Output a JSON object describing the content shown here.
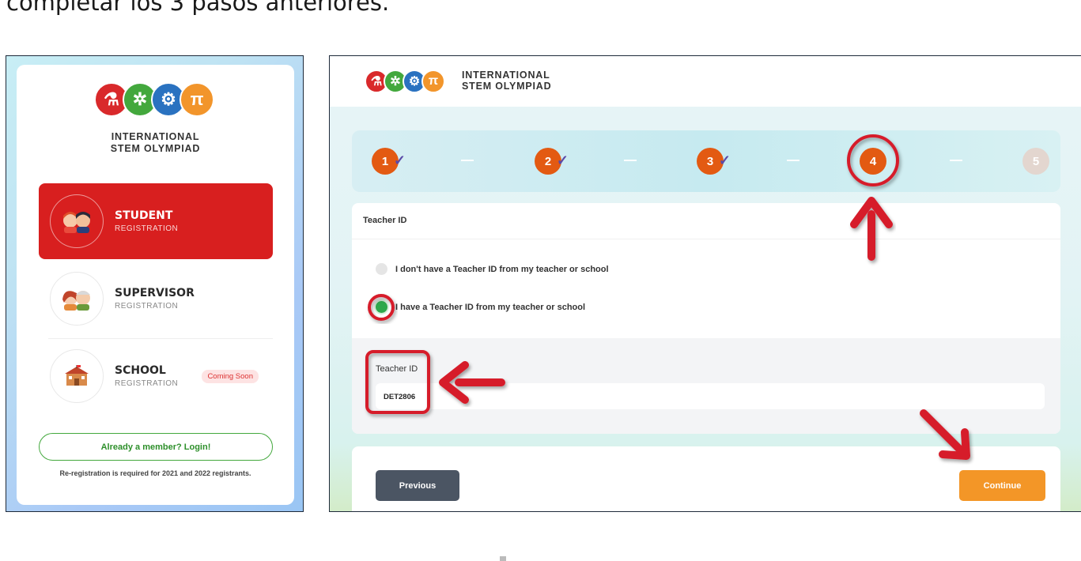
{
  "heading": "completar los 3 pasos anteriores.",
  "brand": {
    "line1": "INTERNATIONAL",
    "line2": "STEM OLYMPIAD",
    "logo_glyphs": [
      "⚗",
      "✲",
      "⚙",
      "π"
    ]
  },
  "registration": {
    "items": [
      {
        "title": "STUDENT",
        "subtitle": "REGISTRATION",
        "icon": "students-avatar-icon",
        "active": true
      },
      {
        "title": "SUPERVISOR",
        "subtitle": "REGISTRATION",
        "icon": "supervisors-avatar-icon",
        "active": false
      },
      {
        "title": "SCHOOL",
        "subtitle": "REGISTRATION",
        "icon": "school-building-icon",
        "active": false,
        "badge": "Coming Soon"
      }
    ],
    "login_label": "Already a member? Login!",
    "note": "Re-registration is required for 2021 and 2022 registrants."
  },
  "steps": [
    {
      "number": "1",
      "state": "done"
    },
    {
      "number": "2",
      "state": "done"
    },
    {
      "number": "3",
      "state": "done"
    },
    {
      "number": "4",
      "state": "current"
    },
    {
      "number": "5",
      "state": "upcoming"
    }
  ],
  "teacher": {
    "section_title": "Teacher ID",
    "options": [
      {
        "label": "I don't have a Teacher ID from my teacher or school",
        "selected": false
      },
      {
        "label": "I have a Teacher ID from my teacher or school",
        "selected": true
      }
    ],
    "field_label": "Teacher ID",
    "field_value": "DET2806"
  },
  "nav": {
    "previous_label": "Previous",
    "continue_label": "Continue"
  },
  "colors": {
    "brand_red": "#d81f1f",
    "step_orange": "#e35a12",
    "continue_orange": "#f39627",
    "success_green": "#2ea84c",
    "annotation_red": "#d61f2c"
  }
}
